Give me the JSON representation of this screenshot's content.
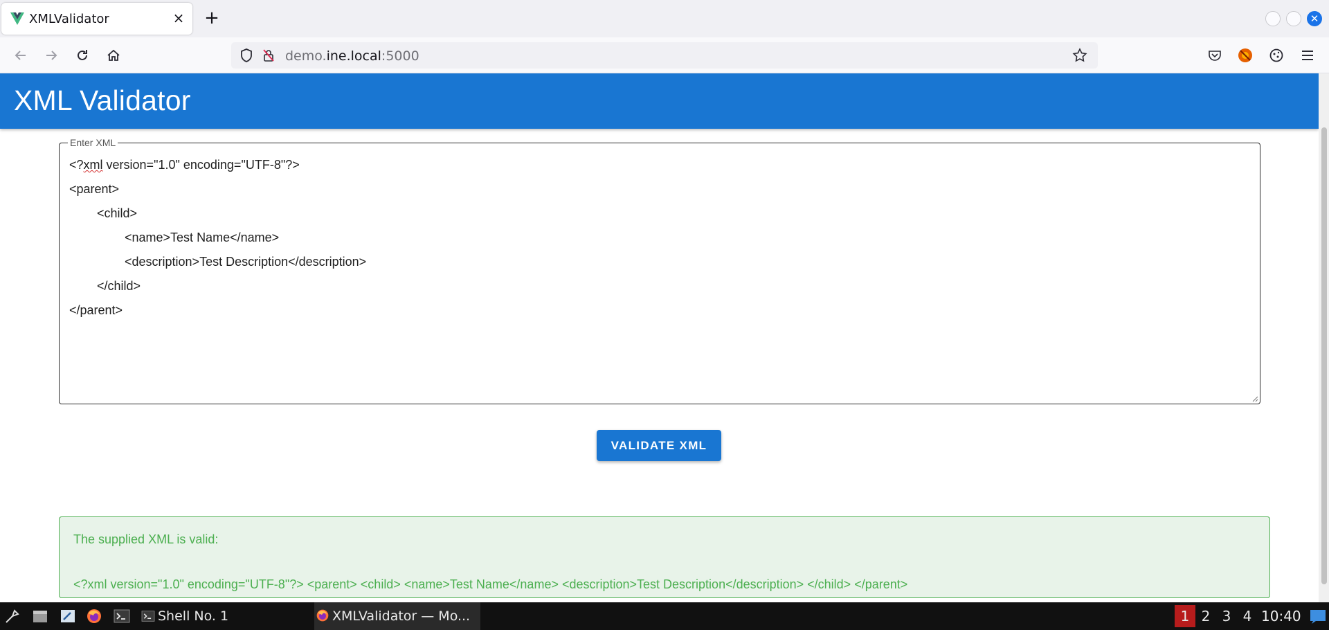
{
  "browser": {
    "tab_title": "XMLValidator",
    "tab_close": "×",
    "new_tab": "+",
    "url_host_pre": "demo.",
    "url_host_main": "ine.local",
    "url_port": ":5000"
  },
  "app": {
    "title": "XML Validator",
    "input_legend": "Enter XML",
    "xml_lines": [
      {
        "indent": "",
        "text": "<?xml version=\"1.0\" encoding=\"UTF-8\"?>"
      },
      {
        "indent": "",
        "text": "<parent>"
      },
      {
        "indent": "\t",
        "text": "<child>"
      },
      {
        "indent": "\t\t",
        "text": "<name>Test Name</name>"
      },
      {
        "indent": "\t\t",
        "text": "<description>Test Description</description>"
      },
      {
        "indent": "\t",
        "text": "</child>"
      },
      {
        "indent": "",
        "text": "</parent>"
      }
    ],
    "validate_button": "VALIDATE XML",
    "result_title": "The supplied XML is valid:",
    "result_xml": "<?xml version=\"1.0\" encoding=\"UTF-8\"?> <parent> <child> <name>Test Name</name> <description>Test Description</description> </child> </parent>"
  },
  "taskbar": {
    "task_shell": "Shell No. 1",
    "task_browser": "XMLValidator — Mo...",
    "workspaces": [
      "1",
      "2",
      "3",
      "4"
    ],
    "active_workspace": "1",
    "clock": "10:40"
  },
  "colors": {
    "header": "#1976d2",
    "button": "#1976d2",
    "success_text": "#4caf50",
    "success_bg": "#e8f3e9",
    "active_workspace": "#b71c1c"
  },
  "icons": [
    "vue-favicon",
    "back-arrow-icon",
    "forward-arrow-icon",
    "reload-icon",
    "home-icon",
    "shield-icon",
    "insecure-lock-icon",
    "bookmark-star-icon",
    "pocket-icon",
    "extension-icon",
    "cookie-icon",
    "hamburger-menu-icon"
  ]
}
